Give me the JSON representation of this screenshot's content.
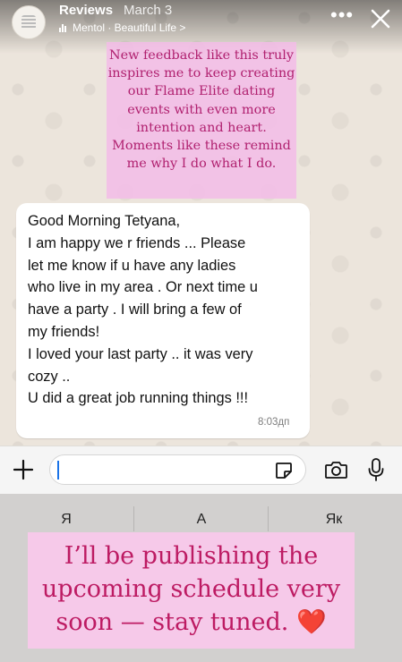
{
  "header": {
    "account_name": "Reviews",
    "post_time": "March 3",
    "music_label": "Mentol · Beautiful Life >"
  },
  "story_top_text": "New feedback like this truly inspires me to keep creating our Flame Elite dating events with even more intention and heart. Moments like these remind me why I do what I do.",
  "message": {
    "lines": [
      "Good Morning Tetyana,",
      "I am happy we r friends ... Please",
      "let me know if u have any ladies",
      "who live in my area . Or next time u",
      "have a party . I will bring a few of",
      "my friends!",
      "I loved your last party .. it was very",
      "cozy ..",
      "U did a great job running things !!!"
    ],
    "time": "8:03дп"
  },
  "keyboard_suggestions": [
    "Я",
    "А",
    "Як"
  ],
  "story_bottom_text": {
    "lines": [
      "I’ll be publishing the",
      "upcoming schedule very",
      "soon — stay tuned."
    ],
    "emoji": "❤️"
  },
  "colors": {
    "story_box_pink": "#f3bce8",
    "story_text": "#b0206f",
    "chat_wallpaper": "#ece5dc",
    "bubble": "#ffffff",
    "keyboard": "#d2d0cf"
  },
  "icons": [
    "more-icon",
    "close-icon",
    "plus-icon",
    "sticker-icon",
    "camera-icon",
    "mic-icon"
  ]
}
